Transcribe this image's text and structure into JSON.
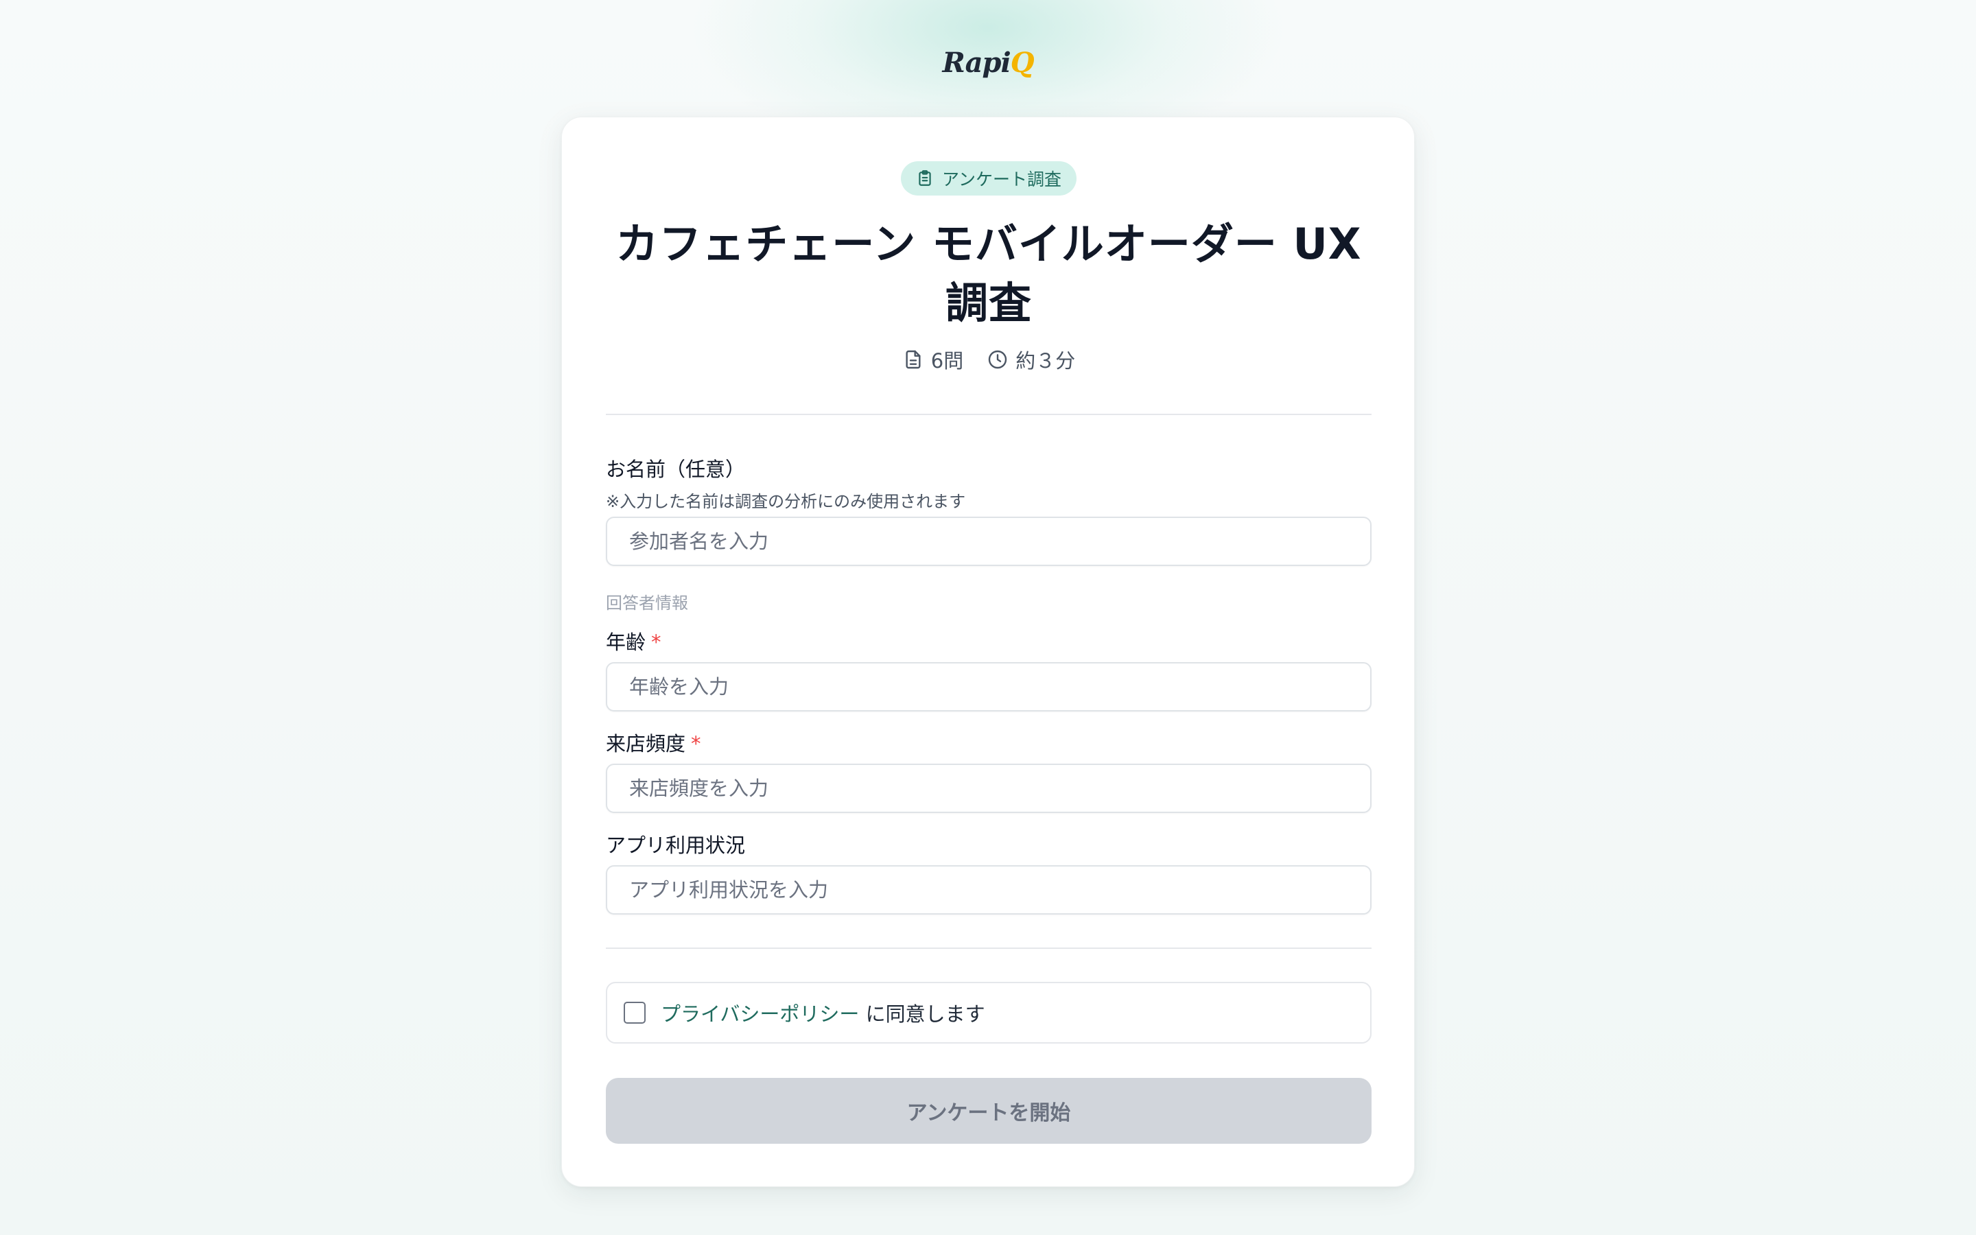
{
  "brand": {
    "logo_main": "Rapi",
    "logo_accent": "Q"
  },
  "badge": {
    "label": "アンケート調査",
    "icon": "clipboard-icon"
  },
  "survey": {
    "title": "カフェチェーン モバイルオーダー UX 調査",
    "question_count": "6問",
    "duration": "約３分"
  },
  "fields": {
    "name": {
      "label": "お名前（任意）",
      "hint": "※入力した名前は調査の分析にのみ使用されます",
      "placeholder": "参加者名を入力"
    },
    "section_label": "回答者情報",
    "age": {
      "label": "年齢",
      "required_mark": "*",
      "placeholder": "年齢を入力"
    },
    "visit_frequency": {
      "label": "来店頻度",
      "required_mark": "*",
      "placeholder": "来店頻度を入力"
    },
    "app_usage": {
      "label": "アプリ利用状況",
      "placeholder": "アプリ利用状況を入力"
    }
  },
  "consent": {
    "link_text": "プライバシーポリシー",
    "text": "に同意します",
    "checked": false
  },
  "submit": {
    "label": "アンケートを開始"
  },
  "colors": {
    "accent": "#1f6b5e",
    "badge_bg": "#d3f1ea",
    "required": "#ef4444",
    "button_disabled_bg": "#d1d5db"
  }
}
